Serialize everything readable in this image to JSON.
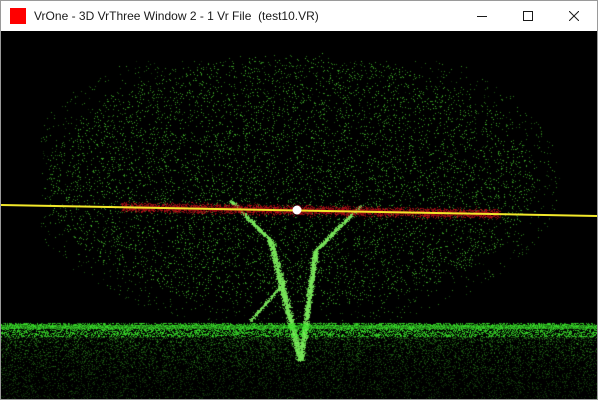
{
  "window": {
    "title": "VrOne - 3D VrThree Window 2 - 1 Vr File  (test10.VR)",
    "app_icon": "app-icon-red-square",
    "app_icon_color": "#ff0000",
    "controls": {
      "minimize_icon": "minimize-icon",
      "maximize_icon": "maximize-icon",
      "close_icon": "close-icon"
    }
  },
  "viewport": {
    "background": "#000000",
    "point_colors": {
      "tree_canopy": "#3fae2a",
      "ground": "#39e02a",
      "selected_slice": "#c0121a"
    },
    "line_color": "#f2e82a",
    "cursor_color": "#ffffff"
  }
}
